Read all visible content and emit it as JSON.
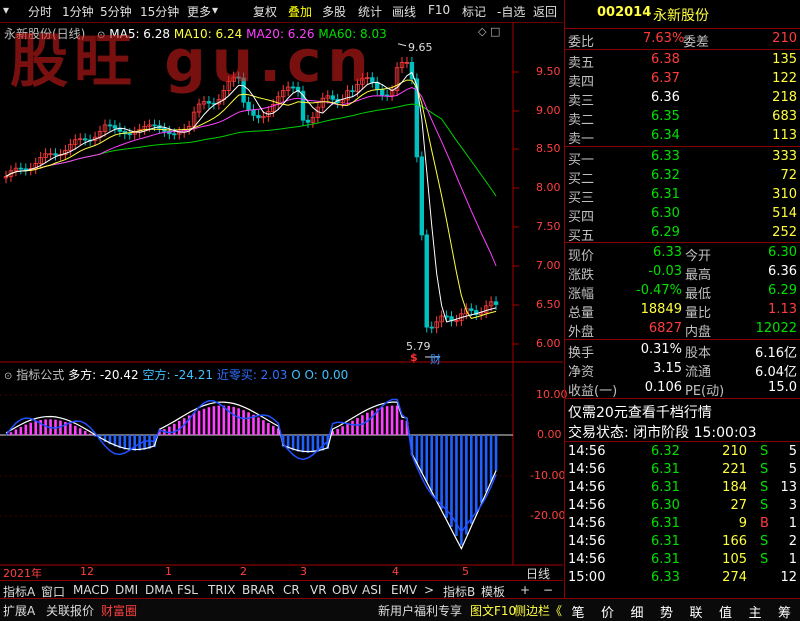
{
  "menu": [
    "分时",
    "1分钟",
    "5分钟",
    "15分钟",
    "更多",
    "复权",
    "叠加",
    "多股",
    "统计",
    "画线",
    "F10",
    "标记",
    "-自选",
    "返回"
  ],
  "menu_active_index": 6,
  "header": {
    "name": "永新股份(日线)",
    "ma5": "MA5: 6.28",
    "ma10": "MA10: 6.24",
    "ma20": "MA20: 6.26",
    "ma60": "MA60: 8.03"
  },
  "watermark": "股旺 gu.cn",
  "price_marks": {
    "high": "9.65",
    "low": "5.79",
    "s_badge": "$",
    "cai_badge": "财"
  },
  "price_axis": [
    "9.50",
    "9.00",
    "8.50",
    "8.00",
    "7.50",
    "7.00",
    "6.50",
    "6.00"
  ],
  "indicator": {
    "name": "指标公式",
    "duofang": "多方: -20.42",
    "kongfang": "空方: -24.21",
    "signal": "近零买: 2.03",
    "oo": "O O: 0.00"
  },
  "indicator_axis": [
    "10.00",
    "0.00",
    "-10.00",
    "-20.00"
  ],
  "date_axis": {
    "year": "2021年",
    "months": [
      "12",
      "1",
      "2",
      "3",
      "4",
      "5"
    ],
    "period": "日线"
  },
  "tabs": [
    "指标A",
    "窗口",
    "MACD",
    "DMI",
    "DMA",
    "FSL",
    "TRIX",
    "BRAR",
    "CR",
    "VR",
    "OBV",
    "ASI",
    "EMV",
    "指标B",
    "模板",
    "+",
    "−"
  ],
  "status": {
    "left": [
      "扩展A",
      "关联报价",
      "财富圈"
    ],
    "promo": "新用户福利专享",
    "f10": "图文F10",
    "side": "侧边栏《"
  },
  "bottom_buttons": [
    "笔",
    "价",
    "细",
    "势",
    "联",
    "值",
    "主",
    "筹"
  ],
  "quote": {
    "code": "002014",
    "name": "永新股份",
    "weibi_label": "委比",
    "weibi": "7.63%",
    "weicha_label": "委差",
    "weicha": "210",
    "asks": [
      {
        "label": "卖五",
        "price": "6.38",
        "vol": "135"
      },
      {
        "label": "卖四",
        "price": "6.37",
        "vol": "122"
      },
      {
        "label": "卖三",
        "price": "6.36",
        "vol": "218"
      },
      {
        "label": "卖二",
        "price": "6.35",
        "vol": "683"
      },
      {
        "label": "卖一",
        "price": "6.34",
        "vol": "113"
      }
    ],
    "bids": [
      {
        "label": "买一",
        "price": "6.33",
        "vol": "333"
      },
      {
        "label": "买二",
        "price": "6.32",
        "vol": "72"
      },
      {
        "label": "买三",
        "price": "6.31",
        "vol": "310"
      },
      {
        "label": "买四",
        "price": "6.30",
        "vol": "514"
      },
      {
        "label": "买五",
        "price": "6.29",
        "vol": "252"
      }
    ],
    "stats": [
      {
        "l1": "现价",
        "v1": "6.33",
        "l2": "今开",
        "v2": "6.30"
      },
      {
        "l1": "涨跌",
        "v1": "-0.03",
        "l2": "最高",
        "v2": "6.36"
      },
      {
        "l1": "涨幅",
        "v1": "-0.47%",
        "l2": "最低",
        "v2": "6.29"
      },
      {
        "l1": "总量",
        "v1": "18849",
        "l2": "量比",
        "v2": "1.13"
      },
      {
        "l1": "外盘",
        "v1": "6827",
        "l2": "内盘",
        "v2": "12022"
      }
    ],
    "fund": [
      {
        "l1": "换手",
        "v1": "0.31%",
        "l2": "股本",
        "v2": "6.16亿"
      },
      {
        "l1": "净资",
        "v1": "3.15",
        "l2": "流通",
        "v2": "6.04亿"
      },
      {
        "l1": "收益(一)",
        "v1": "0.106",
        "l2": "PE(动)",
        "v2": "15.0"
      }
    ],
    "promo": "仅需20元查看千档行情",
    "trade_state": "交易状态: 闭市阶段 15:00:03",
    "ticks": [
      {
        "t": "14:56",
        "p": "6.32",
        "v": "210",
        "bs": "S",
        "n": "5"
      },
      {
        "t": "14:56",
        "p": "6.31",
        "v": "221",
        "bs": "S",
        "n": "5"
      },
      {
        "t": "14:56",
        "p": "6.31",
        "v": "184",
        "bs": "S",
        "n": "13"
      },
      {
        "t": "14:56",
        "p": "6.30",
        "v": "27",
        "bs": "S",
        "n": "3"
      },
      {
        "t": "14:56",
        "p": "6.31",
        "v": "9",
        "bs": "B",
        "n": "1"
      },
      {
        "t": "14:56",
        "p": "6.31",
        "v": "166",
        "bs": "S",
        "n": "2"
      },
      {
        "t": "14:56",
        "p": "6.31",
        "v": "105",
        "bs": "S",
        "n": "1"
      },
      {
        "t": "15:00",
        "p": "6.33",
        "v": "274",
        "bs": "",
        "n": "12"
      }
    ]
  },
  "colors": {
    "up": "#ff3c3c",
    "down": "#00e000",
    "ma5": "#ffffff",
    "ma10": "#ffff40",
    "ma20": "#ff40ff",
    "ma60": "#00d000",
    "bar_pos": "#ff40ff",
    "bar_neg": "#2060ff"
  },
  "chart_data": {
    "type": "candlestick",
    "description_fields": "price series with moving averages; indicator oscillator below",
    "price_ylim": [
      5.7,
      9.8
    ],
    "ma60_samples": [
      7.9,
      8.05,
      8.15,
      8.2,
      8.25,
      8.3,
      8.38,
      8.45,
      8.5,
      8.55,
      8.6,
      8.65,
      8.7,
      8.8,
      8.9,
      8.95,
      9.0,
      9.05,
      9.1,
      9.1,
      9.05,
      8.8,
      8.5,
      8.3,
      8.1
    ],
    "indicator_ylim": [
      -27,
      14
    ]
  }
}
